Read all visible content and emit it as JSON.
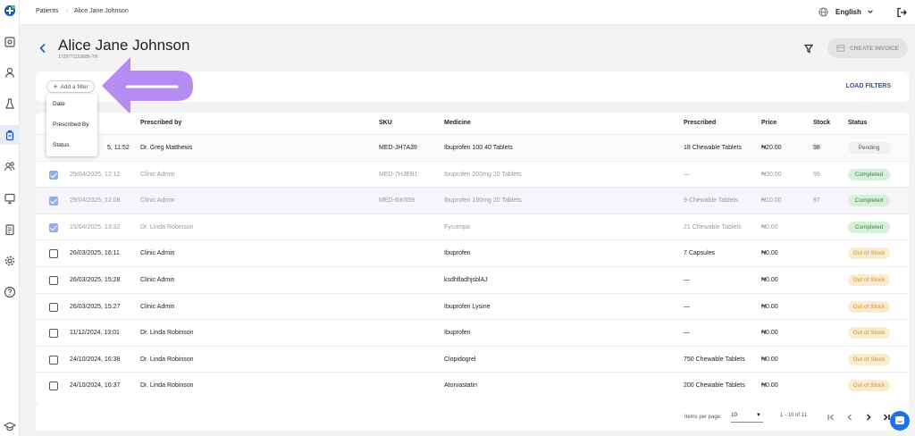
{
  "breadcrumb": {
    "root": "Patients",
    "current": "Alice Jane Johnson"
  },
  "language": "English",
  "patient": {
    "name": "Alice Jane Johnson",
    "id": "1729771153686-TH"
  },
  "actions": {
    "create_invoice": "CREATE INVOICE"
  },
  "filters": {
    "add_filter": "Add a filter",
    "load_filters": "LOAD FILTERS",
    "options": [
      "Date",
      "Prescribed By",
      "Status"
    ]
  },
  "columns": {
    "prescribed_by": "Prescribed by",
    "sku": "SKU",
    "medicine": "Medicine",
    "prescribed": "Prescribed",
    "price": "Price",
    "stock": "Stock",
    "status": "Status"
  },
  "rows": [
    {
      "date": "5, 11:52",
      "by": "Dr. Greg Matthews",
      "sku": "MED-JH7A39",
      "medicine": "Ibuprofen 100 40 Tablets",
      "prescribed": "18 Chewable Tablets",
      "price": "₦20.00",
      "stock": "98",
      "status": "Pending",
      "checked": false,
      "dim": false
    },
    {
      "date": "29/04/2025, 12:12",
      "by": "Clinic Admin",
      "sku": "MED-7HJEB1",
      "medicine": "Ibuprofen 200mg 20 Tablets",
      "prescribed": "—",
      "price": "₦30.00",
      "stock": "99",
      "status": "Completed",
      "checked": true,
      "dim": true
    },
    {
      "date": "29/04/2025, 12:08",
      "by": "Clinic Admin",
      "sku": "MED-6IK659",
      "medicine": "Ibuprofen 100mg 20 Tablets",
      "prescribed": "9 Chewable Tablets",
      "price": "₦10.00",
      "stock": "97",
      "status": "Completed",
      "checked": true,
      "dim": true
    },
    {
      "date": "15/04/2025, 13:32",
      "by": "Dr. Linda Robinson",
      "sku": "",
      "medicine": "Fycompa",
      "prescribed": "21 Chewable Tablets",
      "price": "₦0.00",
      "stock": "",
      "status": "Completed",
      "checked": true,
      "dim": true
    },
    {
      "date": "26/03/2025, 16:11",
      "by": "Clinic Admin",
      "sku": "",
      "medicine": "Ibuprofen",
      "prescribed": "7 Capsules",
      "price": "₦0.00",
      "stock": "",
      "status": "Out of Stock",
      "checked": false,
      "dim": false
    },
    {
      "date": "26/03/2025, 15:28",
      "by": "Clinic Admin",
      "sku": "",
      "medicine": "ksdhfladhjsblAJ",
      "prescribed": "—",
      "price": "₦0.00",
      "stock": "",
      "status": "Out of Stock",
      "checked": false,
      "dim": false
    },
    {
      "date": "26/03/2025, 15:27",
      "by": "Clinic Admin",
      "sku": "",
      "medicine": "Ibuprofen Lysine",
      "prescribed": "—",
      "price": "₦0.00",
      "stock": "",
      "status": "Out of Stock",
      "checked": false,
      "dim": false
    },
    {
      "date": "11/12/2024, 13:01",
      "by": "Dr. Linda Robinson",
      "sku": "",
      "medicine": "Ibuprofen",
      "prescribed": "—",
      "price": "₦0.00",
      "stock": "",
      "status": "Out of Stock",
      "checked": false,
      "dim": false
    },
    {
      "date": "24/10/2024, 16:38",
      "by": "Dr. Linda Robinson",
      "sku": "",
      "medicine": "Clopidogrel",
      "prescribed": "750 Chewable Tablets",
      "price": "₦0.00",
      "stock": "",
      "status": "Out of Stock",
      "checked": false,
      "dim": false
    },
    {
      "date": "24/10/2024, 16:37",
      "by": "Dr. Linda Robinson",
      "sku": "",
      "medicine": "Atorvastatin",
      "prescribed": "200 Chewable Tablets",
      "price": "₦0.00",
      "stock": "",
      "status": "Out of Stock",
      "checked": false,
      "dim": false
    }
  ],
  "pagination": {
    "items_per_page_label": "Items per page:",
    "items_per_page": "10",
    "range": "1 - 10 of 11"
  },
  "colors": {
    "accent": "#1a56c7",
    "arrow": "#b48cf2"
  }
}
